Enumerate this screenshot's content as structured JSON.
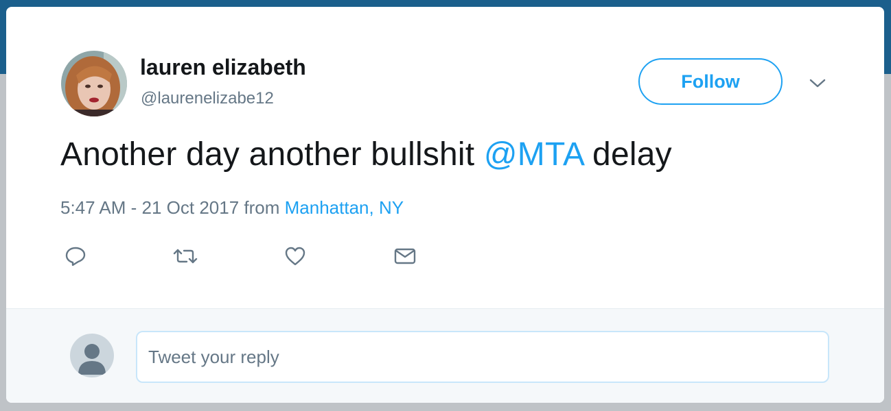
{
  "colors": {
    "accent": "#1da1f2",
    "text_primary": "#14171a",
    "text_secondary": "#657786",
    "reply_bg": "#f5f8fa"
  },
  "user": {
    "display_name": "lauren elizabeth",
    "handle": "@laurenelizabe12",
    "avatar_icon": "profile-photo"
  },
  "header": {
    "follow_label": "Follow",
    "menu_icon": "chevron-down-icon"
  },
  "tweet": {
    "text_before": "Another day another bullshit ",
    "mention": "@MTA",
    "text_after": " delay",
    "timestamp": "5:47 AM - 21 Oct 2017",
    "from_label": "from",
    "location": "Manhattan, NY"
  },
  "actions": [
    {
      "name": "reply",
      "icon": "reply-icon"
    },
    {
      "name": "retweet",
      "icon": "retweet-icon"
    },
    {
      "name": "like",
      "icon": "heart-icon"
    },
    {
      "name": "direct-message",
      "icon": "envelope-icon"
    }
  ],
  "reply": {
    "placeholder": "Tweet your reply",
    "avatar_icon": "default-avatar-icon"
  }
}
